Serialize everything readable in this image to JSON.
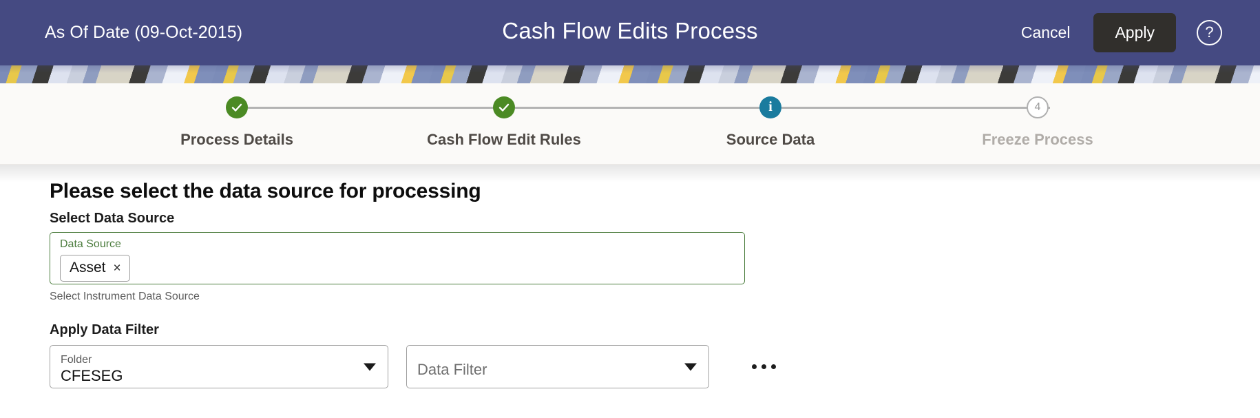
{
  "header": {
    "as_of_date": "As Of Date (09-Oct-2015)",
    "title": "Cash Flow Edits Process",
    "cancel_label": "Cancel",
    "apply_label": "Apply",
    "help_label": "?",
    "background_color": "#454a82",
    "apply_background_color": "#312f2c"
  },
  "stepper": {
    "steps": [
      {
        "label": "Process Details",
        "state": "done",
        "marker": "✓"
      },
      {
        "label": "Cash Flow Edit Rules",
        "state": "done",
        "marker": "✓"
      },
      {
        "label": "Source Data",
        "state": "current",
        "marker": "i"
      },
      {
        "label": "Freeze Process",
        "state": "pending",
        "marker": "4"
      }
    ],
    "done_color": "#4b8a24",
    "current_color": "#1a7b9e",
    "pending_color": "#b0b0b0",
    "connector_color": "#b3b3b3"
  },
  "main": {
    "heading": "Please select the data source for processing",
    "data_source": {
      "section_label": "Select Data Source",
      "field_legend": "Data Source",
      "chips": [
        {
          "label": "Asset",
          "remove": "×"
        }
      ],
      "helper_text": "Select Instrument Data Source",
      "border_color": "#4b7c3d"
    },
    "data_filter": {
      "section_label": "Apply Data Filter",
      "folder": {
        "label": "Folder",
        "value": "CFESEG"
      },
      "filter": {
        "placeholder": "Data Filter",
        "value": ""
      },
      "more_options_label": "•••"
    }
  }
}
